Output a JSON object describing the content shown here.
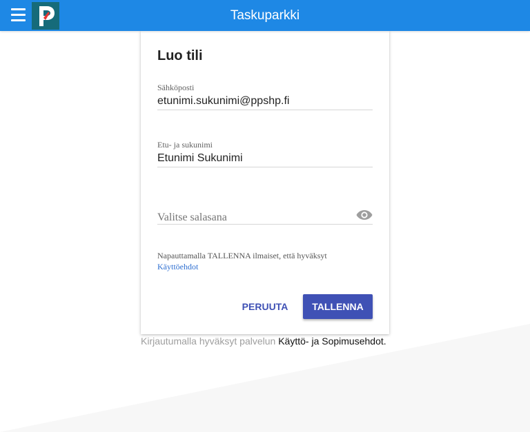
{
  "app": {
    "title": "Taskuparkki"
  },
  "form": {
    "title": "Luo tili",
    "email": {
      "label": "Sähköposti",
      "value": "etunimi.sukunimi@ppshp.fi"
    },
    "name": {
      "label": "Etu- ja sukunimi",
      "value": "Etunimi Sukunimi"
    },
    "password": {
      "placeholder": "Valitse salasana",
      "value": ""
    },
    "terms": {
      "text": "Napauttamalla TALLENNA ilmaiset, että hyväksyt",
      "link": "Käyttöehdot"
    },
    "cancel_label": "PERUUTA",
    "save_label": "TALLENNA"
  },
  "footer": {
    "text": "Kirjautumalla hyväksyt palvelun",
    "link": "Käyttö- ja Sopimusehdot."
  },
  "colors": {
    "topbar": "#1e88e5",
    "primary": "#3f51b5",
    "link": "#2e6fd1",
    "logo_bg": "#166b7a"
  },
  "icons": {
    "menu": "hamburger-menu-icon",
    "logo": "app-logo-p",
    "password_toggle": "eye-icon"
  }
}
